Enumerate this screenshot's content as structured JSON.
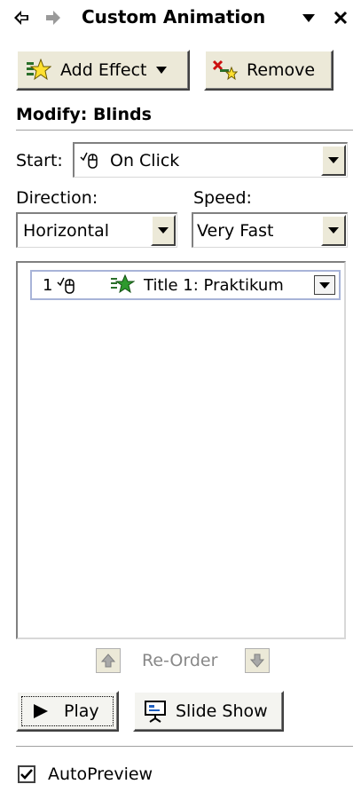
{
  "header": {
    "title": "Custom Animation",
    "back_icon": "back-arrow-icon",
    "forward_icon": "forward-arrow-icon",
    "menu_icon": "dropdown-icon",
    "close_icon": "close-icon"
  },
  "toolbar": {
    "add_effect_label": "Add Effect",
    "remove_label": "Remove"
  },
  "modify": {
    "heading": "Modify: Blinds",
    "start_label": "Start:",
    "start_value": "On Click",
    "direction_label": "Direction:",
    "direction_value": "Horizontal",
    "speed_label": "Speed:",
    "speed_value": "Very Fast"
  },
  "animation_list": {
    "items": [
      {
        "number": "1",
        "label": "Title 1: Praktikum"
      }
    ]
  },
  "reorder": {
    "label": "Re-Order"
  },
  "playback": {
    "play_label": "Play",
    "slideshow_label": "Slide Show"
  },
  "options": {
    "autopreview_label": "AutoPreview",
    "autopreview_checked": true
  }
}
